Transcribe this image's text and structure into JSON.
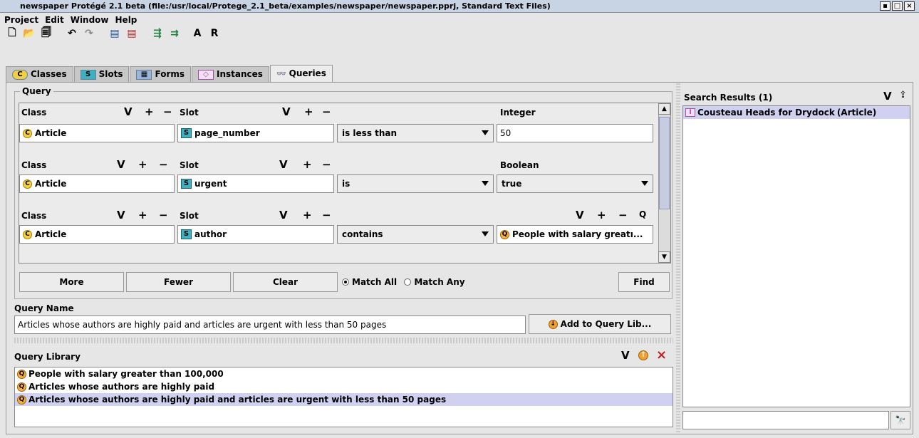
{
  "window": {
    "title": "newspaper  Protégé 2.1 beta   (file:/usr/local/Protege_2.1_beta/examples/newspaper/newspaper.pprj, Standard Text Files)",
    "controls": [
      "▪",
      "□",
      "×"
    ]
  },
  "menu": [
    "Project",
    "Edit",
    "Window",
    "Help"
  ],
  "toolbar": {
    "icons": [
      "new-project-icon",
      "open-project-icon",
      "save-project-icon",
      "undo-icon",
      "redo-icon",
      "copy-icon",
      "delete-icon",
      "insert-icon",
      "format-icon"
    ],
    "a_label": "A",
    "r_label": "R"
  },
  "tabs": [
    {
      "label": "Classes",
      "icon": "C"
    },
    {
      "label": "Slots",
      "icon": "S"
    },
    {
      "label": "Forms",
      "icon": "▦"
    },
    {
      "label": "Instances",
      "icon": "◇"
    },
    {
      "label": "Queries",
      "icon": "🔭"
    }
  ],
  "query": {
    "group_label": "Query",
    "rows": [
      {
        "class_header": "Class",
        "slot_header": "Slot",
        "value_header": "Integer",
        "class_value": "Article",
        "slot_value": "page_number",
        "operator": "is less than",
        "value": "50"
      },
      {
        "class_header": "Class",
        "slot_header": "Slot",
        "value_header": "Boolean",
        "class_value": "Article",
        "slot_value": "urgent",
        "operator": "is",
        "value": "true"
      },
      {
        "class_header": "Class",
        "slot_header": "Slot",
        "value_header": "",
        "class_value": "Article",
        "slot_value": "author",
        "operator": "contains",
        "value": "People with salary greatı..."
      }
    ],
    "symbols": {
      "v": "V",
      "plus": "+",
      "minus": "−",
      "q": "Q"
    },
    "buttons": {
      "more": "More",
      "fewer": "Fewer",
      "clear": "Clear",
      "find": "Find"
    },
    "match_all": "Match All",
    "match_any": "Match Any",
    "match_selected": "all"
  },
  "query_name": {
    "label": "Query Name",
    "value": "Articles whose authors are highly paid and articles are urgent with less than 50 pages",
    "add_button": "Add to Query Lib..."
  },
  "library": {
    "label": "Query Library",
    "items": [
      "People with salary greater than 100,000",
      "Articles whose authors are highly paid",
      "Articles whose authors are highly paid and articles are urgent with less than 50 pages"
    ],
    "selected_index": 2
  },
  "search": {
    "label": "Search Results (1)",
    "results": [
      {
        "name": "Cousteau Heads for Drydock",
        "type": "(Article)"
      }
    ]
  },
  "colors": {
    "selection": "#d0d0f0",
    "titlebar": "#c8d4e4"
  }
}
